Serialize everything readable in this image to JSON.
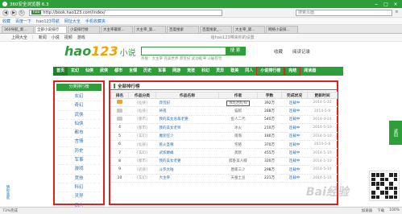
{
  "browser": {
    "title": "360安全浏览器 6.3",
    "address": "http://book.hao123.com/index/",
    "search_placeholder": "搜索页面",
    "window_controls": [
      "−",
      "□",
      "×"
    ]
  },
  "favorites": [
    "收藏",
    "百度一下",
    "hao123导航",
    "网址大全",
    "手机收藏夹"
  ],
  "tabs": [
    "360导航_新...",
    "全部小说排行",
    "小说排行榜",
    "大主宰最新...",
    "大主宰_第...",
    "百度搜索",
    "百度搜索_...",
    "大主宰_第...",
    "网络小说排..."
  ],
  "page_header": {
    "links": [
      "上网大全",
      "新闻",
      "小说",
      "视频",
      "游戏"
    ],
    "ad": "给hao123带来你的设置"
  },
  "logo": {
    "hao": "hao",
    "num": "123",
    "section": "小说"
  },
  "search": {
    "button": "搜 索",
    "hotwords": "热搜：大主宰  完美世界  莽荒纪  武动乾坤  斗破苍穹"
  },
  "collect": {
    "fav": "收藏",
    "history": "阅读记录"
  },
  "nav": [
    "首页",
    "玄幻",
    "仙侠",
    "武侠",
    "都市",
    "言情",
    "历史",
    "军事",
    "网游",
    "竞技",
    "科幻",
    "灵异",
    "耽美",
    "同人",
    "小说排行榜",
    "完结",
    "阅读器"
  ],
  "sidebar": {
    "heading": "分类排行榜",
    "categories": [
      "玄幻",
      "奇幻",
      "武侠",
      "仙侠",
      "都市",
      "言情",
      "历史",
      "军事",
      "游戏",
      "竞技",
      "科幻",
      "灵异",
      "同人"
    ]
  },
  "ranking": {
    "title": "全部排行榜",
    "headers": [
      "排名",
      "作品分类",
      "作品名称",
      "作者",
      "字数",
      "完成状况",
      "更新时间"
    ],
    "rows": [
      {
        "rank": "1",
        "type": "[仙侠]",
        "name": "莽荒纪",
        "author": "我吃西红柿",
        "words": "392万",
        "status": "连载中",
        "date": "2014-5-10"
      },
      {
        "rank": "2",
        "type": "[仙侠]",
        "name": "将夜",
        "author": "猫腻",
        "words": "288万",
        "status": "连载中",
        "date": "2014-5-9"
      },
      {
        "rank": "3",
        "type": "[都市]",
        "name": "我的美女总裁老婆",
        "author": "鱼人二代",
        "words": "540万",
        "status": "连载中",
        "date": "2014-4-24"
      },
      {
        "rank": "4",
        "type": "[都市]",
        "name": "我的美女老师",
        "author": "冰火",
        "words": "210万",
        "status": "连载中",
        "date": "2014-5-10"
      },
      {
        "rank": "5",
        "type": "[玄幻]",
        "name": "魔装狂少",
        "author": "雨落",
        "words": "180万",
        "status": "连载中",
        "date": "2014-5-10"
      },
      {
        "rank": "6",
        "type": "[仙侠]",
        "name": "惹火圣尊",
        "author": "宅猪",
        "words": "370万",
        "status": "连载中",
        "date": "2014-5-8"
      },
      {
        "rank": "7",
        "type": "[玄幻]",
        "name": "武炼巅峰",
        "author": "莫默",
        "words": "455万",
        "status": "连载中",
        "date": "2014-5-10"
      },
      {
        "rank": "8",
        "type": "[都市]",
        "name": "我的美女老婆",
        "author": "醉卧美人膝",
        "words": "320万",
        "status": "连载中",
        "date": "2014-5-10"
      },
      {
        "rank": "9",
        "type": "[武侠]",
        "name": "斗罗大陆",
        "author": "唐家三少",
        "words": "298万",
        "status": "连载中",
        "date": "2014-5-10"
      },
      {
        "rank": "10",
        "type": "[玄幻]",
        "name": "大主宰",
        "author": "天蚕土豆",
        "words": "221万",
        "status": "连载中",
        "date": "2014-5-10"
      }
    ]
  },
  "right_button": "返回",
  "left_dock": "猜你喜欢",
  "statusbar": {
    "left": "73%完成",
    "items": [
      "加速器",
      "下载"
    ],
    "zoom": "100%"
  },
  "watermark": "Bai经验",
  "colors": {
    "brand_green": "#2e9e3a",
    "highlight_red": "#e02020",
    "link_blue": "#2a6fb8"
  }
}
